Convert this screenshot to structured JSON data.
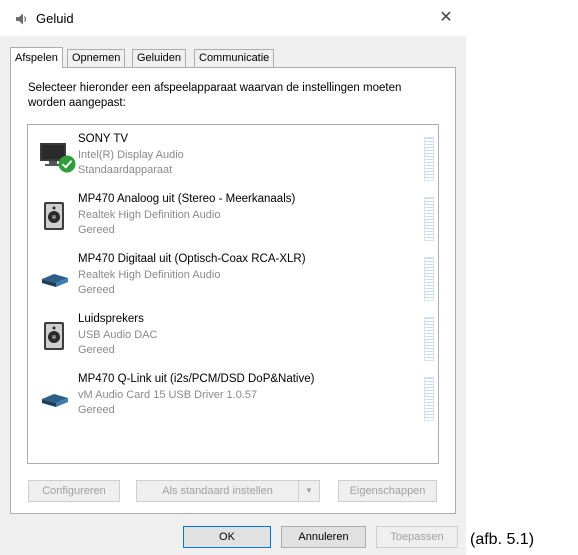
{
  "window": {
    "title": "Geluid",
    "close_glyph": "✕"
  },
  "tabs": [
    {
      "label": "Afspelen",
      "active": true
    },
    {
      "label": "Opnemen",
      "active": false
    },
    {
      "label": "Geluiden",
      "active": false
    },
    {
      "label": "Communicatie",
      "active": false
    }
  ],
  "instruction": "Selecteer hieronder een afspeelapparaat waarvan de instellingen moeten worden aangepast:",
  "devices": [
    {
      "name": "SONY TV",
      "driver": "Intel(R) Display Audio",
      "status": "Standaardapparaat",
      "icon": "monitor-icon",
      "default": true
    },
    {
      "name": "MP470 Analoog uit (Stereo - Meerkanaals)",
      "driver": "Realtek High Definition Audio",
      "status": "Gereed",
      "icon": "speaker-icon"
    },
    {
      "name": "MP470 Digitaal uit (Optisch-Coax RCA-XLR)",
      "driver": "Realtek High Definition Audio",
      "status": "Gereed",
      "icon": "digital-output-icon"
    },
    {
      "name": "Luidsprekers",
      "driver": "USB Audio DAC",
      "status": "Gereed",
      "icon": "speaker-icon"
    },
    {
      "name": "MP470 Q-Link uit (i2s/PCM/DSD DoP&Native)",
      "driver": "vM Audio Card 15 USB Driver 1.0.57",
      "status": "Gereed",
      "icon": "digital-output-icon"
    }
  ],
  "panel_buttons": {
    "configure": "Configureren",
    "set_default": "Als standaard instellen",
    "dropdown_glyph": "▼",
    "properties": "Eigenschappen"
  },
  "dialog_buttons": {
    "ok": "OK",
    "cancel": "Annuleren",
    "apply": "Toepassen"
  },
  "caption": "(afb. 5.1)",
  "colors": {
    "accent": "#0078d7",
    "check_green": "#2e9e3a",
    "meter": "#c9dced"
  }
}
